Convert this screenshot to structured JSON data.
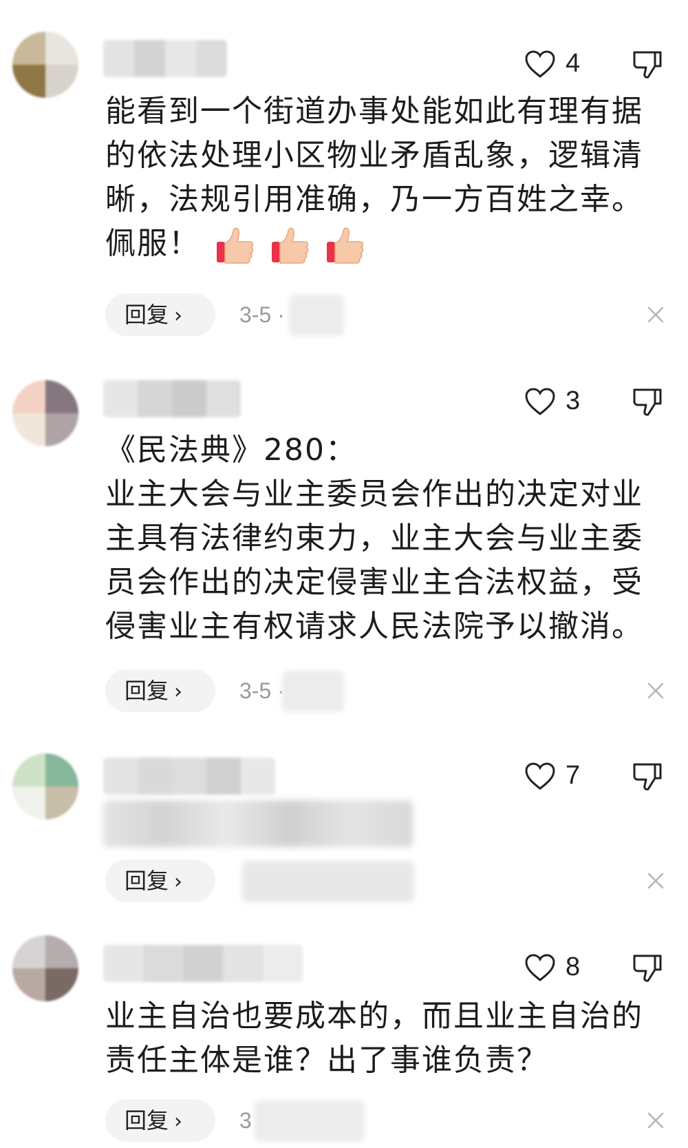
{
  "comments": [
    {
      "likes": "4",
      "lines": [
        "能看到一个街道办事处能如此有理有据",
        "的依法处理小区物业矛盾乱象，逻辑清",
        "晰，法规引用准确，乃一方百姓之幸。",
        "佩服！"
      ],
      "emoji_icons": [
        "thumbs-up-icon",
        "thumbs-up-icon",
        "thumbs-up-icon"
      ],
      "reply_label": "回复",
      "meta": "3-5 ·"
    },
    {
      "likes": "3",
      "lines": [
        "《民法典》280：",
        "业主大会与业主委员会作出的决定对业",
        "主具有法律约束力，业主大会与业主委",
        "员会作出的决定侵害业主合法权益，受",
        "侵害业主有权请求人民法院予以撤消。"
      ],
      "reply_label": "回复",
      "meta": "3-5 ·"
    },
    {
      "likes": "7",
      "lines": [],
      "reply_label": "回复",
      "meta": ""
    },
    {
      "likes": "8",
      "lines": [
        "业主自治也要成本的，而且业主自治的",
        "责任主体是谁？出了事谁负责？"
      ],
      "reply_label": "回复",
      "meta": "3"
    }
  ],
  "colors": {
    "text": "#1c1c1c",
    "meta": "#9a9a9a",
    "reply_bg": "#f3f3f3",
    "thumbs_cuff": "#e8334a",
    "thumbs_hand": "#f7c9a8"
  }
}
